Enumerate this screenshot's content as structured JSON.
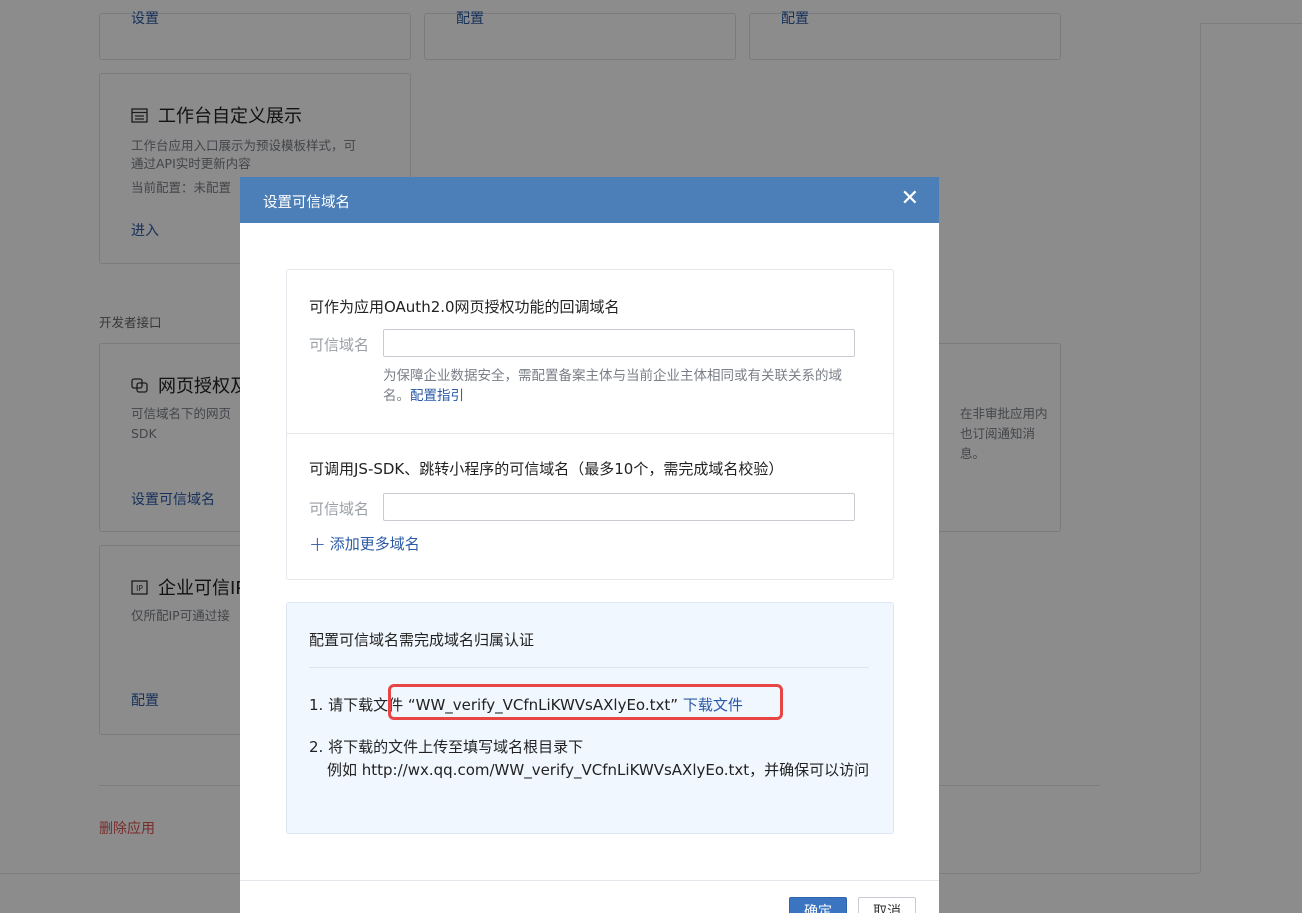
{
  "background": {
    "cards": [
      {
        "link": "设置"
      },
      {
        "link": "配置"
      },
      {
        "link": "配置"
      }
    ],
    "workbench": {
      "title": "工作台自定义展示",
      "desc1": "工作台应用入口展示为预设模板样式，可",
      "desc2": "通过API实时更新内容",
      "desc3": "当前配置：未配置",
      "link": "进入"
    },
    "dev_section_label": "开发者接口",
    "web_auth": {
      "title": "网页授权及JS-SDK",
      "desc1": "可信域名下的网页",
      "desc2": "SDK",
      "link": "设置可信域名"
    },
    "right_card": {
      "desc1": "在非审批应用内",
      "desc2": "也订阅通知消",
      "desc3": "息。"
    },
    "trusted_ip": {
      "title": "企业可信IP",
      "desc": "仅所配IP可通过接",
      "link": "配置"
    },
    "delete_app": "删除应用"
  },
  "modal": {
    "title": "设置可信域名",
    "close_glyph": "✕",
    "oauth": {
      "title": "可作为应用OAuth2.0网页授权功能的回调域名",
      "field_label": "可信域名",
      "field_value": "",
      "hint_prefix": "为保障企业数据安全，需配置备案主体与当前企业主体相同或有关联关系的域名。",
      "hint_link": "配置指引"
    },
    "jssdk": {
      "title": "可调用JS-SDK、跳转小程序的可信域名（最多10个，需完成域名校验）",
      "field_label": "可信域名",
      "field_value": "",
      "add_more": "添加更多域名"
    },
    "verify": {
      "title": "配置可信域名需完成域名归属认证",
      "step1_text": "1. 请下载文件 “WW_verify_VCfnLiKWVsAXlyEo.txt”",
      "step1_link": "下载文件",
      "step2_line1": "2. 将下载的文件上传至填写域名根目录下",
      "step2_line2": "例如 http://wx.qq.com/WW_verify_VCfnLiKWVsAXlyEo.txt，并确保可以访问"
    },
    "confirm_label": "确定",
    "cancel_label": "取消"
  }
}
